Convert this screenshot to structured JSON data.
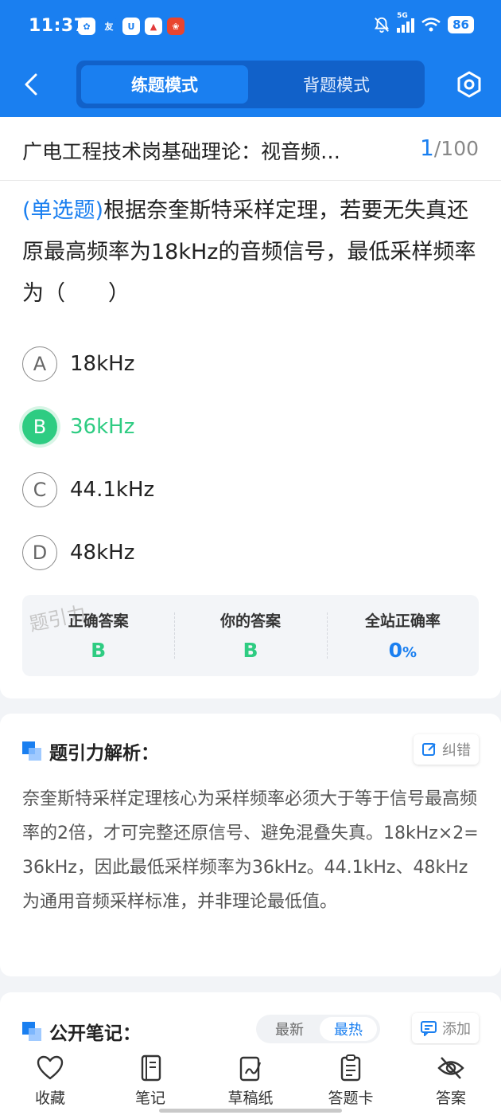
{
  "status_bar": {
    "time": "11:37",
    "network": "5G",
    "battery": "86"
  },
  "nav": {
    "mode_practice": "练题模式",
    "mode_memorize": "背题模式"
  },
  "header": {
    "title": "广电工程技术岗基础理论：视音频…",
    "current": "1",
    "total": "/100"
  },
  "question": {
    "type": "(单选题)",
    "text": "根据奈奎斯特采样定理，若要无失真还原最高频率为18kHz的音频信号，最低采样频率为（　　）",
    "options": [
      {
        "letter": "A",
        "text": "18kHz"
      },
      {
        "letter": "B",
        "text": "36kHz"
      },
      {
        "letter": "C",
        "text": "44.1kHz"
      },
      {
        "letter": "D",
        "text": "48kHz"
      }
    ],
    "selected": "B"
  },
  "stats": {
    "watermark": "题引力",
    "correct_label": "正确答案",
    "correct_value": "B",
    "yours_label": "你的答案",
    "yours_value": "B",
    "rate_label": "全站正确率",
    "rate_value": "0",
    "rate_unit": "%"
  },
  "analysis": {
    "title": "题引力解析：",
    "report_label": "纠错",
    "text": "奈奎斯特采样定理核心为采样频率必须大于等于信号最高频率的2倍，才可完整还原信号、避免混叠失真。18kHz×2=36kHz，因此最低采样频率为36kHz。44.1kHz、48kHz为通用音频采样标准，并非理论最低值。"
  },
  "notes": {
    "title": "公开笔记：",
    "sort_latest": "最新",
    "sort_hot": "最热",
    "add_label": "添加"
  },
  "bottom_bar": {
    "favorite": "收藏",
    "notes": "笔记",
    "scratch": "草稿纸",
    "answer_card": "答题卡",
    "answer": "答案"
  },
  "colors": {
    "primary": "#1a7ff0",
    "correct": "#2ecc82"
  }
}
